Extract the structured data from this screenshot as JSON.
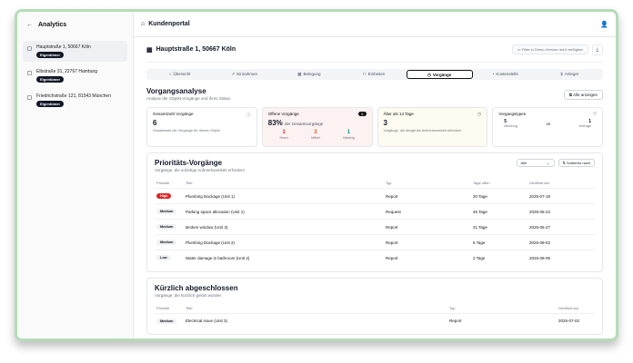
{
  "sidebar": {
    "title": "Analytics",
    "back_icon": "arrow-left-icon",
    "properties": [
      {
        "address": "Hauptstraße 1, 50667 Köln",
        "badge": "Eigentümer",
        "active": true
      },
      {
        "address": "Elbstraße 31, 22767 Hamburg",
        "badge": "Eigentümer",
        "active": false
      },
      {
        "address": "Friedrichstraße 121, 81543 München",
        "badge": "Eigentümer",
        "active": false
      }
    ]
  },
  "header": {
    "title": "Kundenportal"
  },
  "property": {
    "title": "Hauptstraße 1, 50667 Köln",
    "filter_label": "Filter in Demo-Version nicht verfügbar"
  },
  "tabs": [
    "Übersicht",
    "Einnahmen",
    "Belegung",
    "Einheiten",
    "Vorgänge",
    "Kostenstelle",
    "Anleger"
  ],
  "active_tab": 4,
  "vorgang": {
    "title": "Vorgangsanalyse",
    "subtitle": "Analyse der Objekt-Vorgänge und ihres Status",
    "show_all": "Alle anzeigen"
  },
  "cards": {
    "total": {
      "label": "Gesamtzahl Vorgänge",
      "value": "6",
      "desc": "Gesamtzahl der Vorgänge für dieses Objekt"
    },
    "open": {
      "label": "Offene Vorgänge",
      "badge": "5",
      "value": "83%",
      "value_suffix": "der Gesamtvorgänge",
      "prio": [
        {
          "count": "1",
          "label": "Hoch",
          "color": "#dc2626"
        },
        {
          "count": "3",
          "label": "Mittel",
          "color": "#ea580c"
        },
        {
          "count": "1",
          "label": "Niedrig",
          "color": "#0d9488"
        }
      ]
    },
    "old": {
      "label": "Älter als 14 Tage",
      "value": "3",
      "desc": "Vorgänge, die dringende Aufmerksamkeit erfordern"
    },
    "types": {
      "label": "Vorgangstypen",
      "left_count": "5",
      "left_label": "Meldung",
      "vs": "vs",
      "right_count": "1",
      "right_label": "Anfrage"
    }
  },
  "priority": {
    "title": "Prioritäts-Vorgänge",
    "subtitle": "Vorgänge, die sofortige Aufmerksamkeit erfordern",
    "select_value": "Alle",
    "sort_label": "Sortieren nach",
    "columns": [
      "Priorität",
      "Titel",
      "Typ",
      "Tage offen",
      "Geöffnet am"
    ],
    "rows": [
      {
        "priority": "High",
        "level": "high",
        "title": "Plumbing blockage (Unit 1)",
        "type": "Report",
        "days": "20 Tage",
        "opened": "2025-07-18"
      },
      {
        "priority": "Medium",
        "level": "med",
        "title": "Parking space allocation (Unit 1)",
        "type": "Request",
        "days": "46 Tage",
        "opened": "2025-06-22"
      },
      {
        "priority": "Medium",
        "level": "med",
        "title": "Broken window (Unit 3)",
        "type": "Report",
        "days": "41 Tage",
        "opened": "2025-06-27"
      },
      {
        "priority": "Medium",
        "level": "med",
        "title": "Plumbing blockage (Unit 2)",
        "type": "Report",
        "days": "5 Tage",
        "opened": "2025-08-02"
      },
      {
        "priority": "Low",
        "level": "low",
        "title": "Water damage in bathroom (Unit 2)",
        "type": "Report",
        "days": "2 Tage",
        "opened": "2025-08-05"
      }
    ]
  },
  "closed": {
    "title": "Kürzlich abgeschlossen",
    "subtitle": "Vorgänge, die kürzlich gelöst wurden",
    "columns": [
      "Priorität",
      "Titel",
      "Typ",
      "Geöffnet am"
    ],
    "rows": [
      {
        "priority": "Medium",
        "level": "med",
        "title": "Electrical issue (Unit 3)",
        "type": "Report",
        "opened": "2025-07-02"
      }
    ]
  }
}
